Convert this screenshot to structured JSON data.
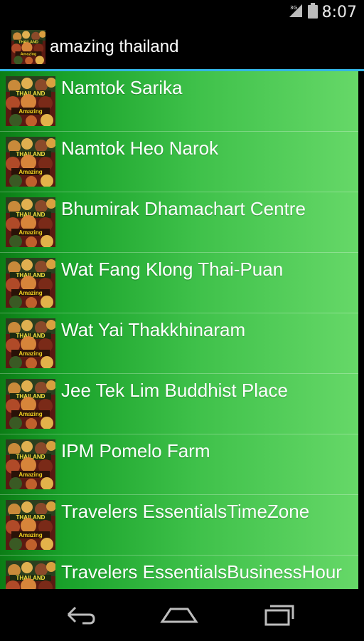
{
  "status_bar": {
    "time": "8:07",
    "icons": [
      "signal-icon",
      "battery-icon"
    ],
    "signal_label": "3G"
  },
  "action_bar": {
    "title": "amazing thailand",
    "icon": "app-logo-icon"
  },
  "list": {
    "items": [
      {
        "label": "Namtok Sarika"
      },
      {
        "label": "Namtok Heo Narok"
      },
      {
        "label": "Bhumirak Dhamachart Centre"
      },
      {
        "label": "Wat Fang Klong Thai-Puan"
      },
      {
        "label": "Wat Yai Thakkhinaram"
      },
      {
        "label": "Jee Tek Lim Buddhist Place"
      },
      {
        "label": "IPM Pomelo Farm"
      },
      {
        "label": "Travelers EssentialsTimeZone"
      },
      {
        "label": "Travelers EssentialsBusinessHour"
      }
    ]
  },
  "nav_bar": {
    "buttons": [
      "back-icon",
      "home-icon",
      "recent-apps-icon"
    ]
  },
  "colors": {
    "accent_divider": "#33b5e5",
    "list_gradient_start": "#0b7d15",
    "list_gradient_end": "#66d868"
  }
}
